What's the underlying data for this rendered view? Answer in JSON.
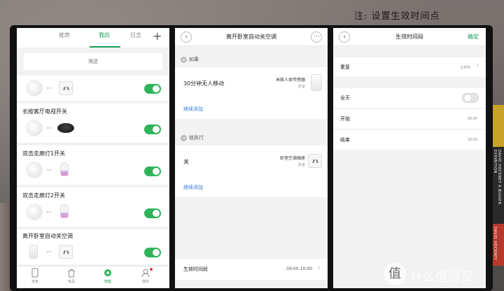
{
  "note": "注: 设置生效时间点",
  "phone1": {
    "tabs": [
      "推荐",
      "我的",
      "日志"
    ],
    "active_tab": "我的",
    "add": "+",
    "filter": "筛选",
    "scenes": [
      {
        "title": "",
        "on": true
      },
      {
        "title": "长按客厅电视开关",
        "on": true
      },
      {
        "title": "双击走廊灯1开关",
        "on": true
      },
      {
        "title": "双击走廊灯2开关",
        "on": true
      },
      {
        "title": "离开卧室自动关空调",
        "on": true
      }
    ],
    "nav": [
      "米家",
      "有品",
      "智能",
      "我的"
    ],
    "active_nav": "智能"
  },
  "phone2": {
    "title": "离开卧室自动关空调",
    "back": "‹",
    "more": "⋯",
    "if_label": "如果",
    "condition": "30分钟无人移动",
    "condition_device": "米家人体传感器",
    "condition_room": "卧室",
    "continue_add": "继续添加",
    "then_label": "就执行",
    "action": "关",
    "action_device": "卧室空调插座",
    "action_room": "卧室",
    "continue_add2": "继续添加",
    "period_label": "生效时间段",
    "period_value": "09:00-10:00",
    "chevron": "›"
  },
  "phone3": {
    "title": "生效时间段",
    "confirm": "确定",
    "repeat_label": "重复",
    "repeat_value": "工作日",
    "allday_label": "全天",
    "allday_on": false,
    "start_label": "开始",
    "start_value": "09:00",
    "end_label": "结束",
    "end_value": "10:00",
    "chevron": "›"
  },
  "decor": {
    "book1": "DAVID HOCKNEY A BIGGER EXHIBITION",
    "book2": "DAVID HOCKNEY",
    "watermark_glyph": "值",
    "watermark": "什么值得买"
  },
  "colors": {
    "accent_green": "#2eb35a",
    "link_blue": "#3a7bd5"
  }
}
